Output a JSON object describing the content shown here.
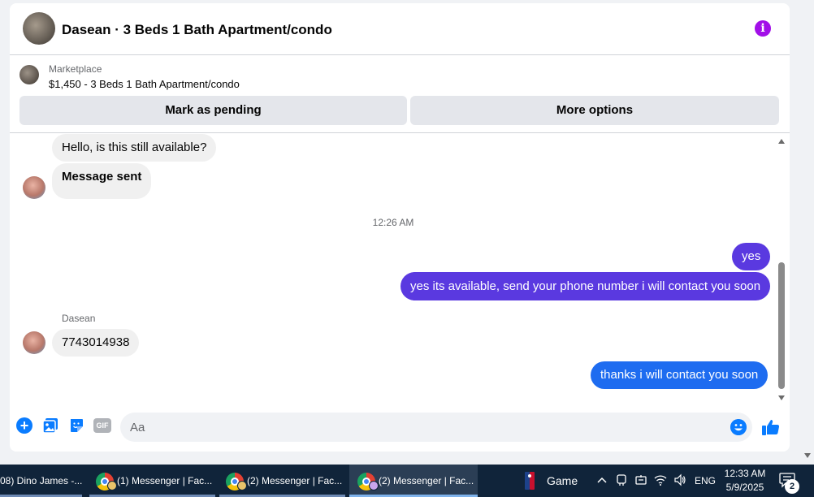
{
  "chat": {
    "title": "Dasean · 3 Beds 1 Bath Apartment/condo",
    "listing": {
      "source": "Marketplace",
      "price_title": "$1,450 - 3 Beds 1 Bath Apartment/condo"
    },
    "buttons": {
      "mark_pending": "Mark as pending",
      "more_options": "More options"
    },
    "messages": [
      {
        "direction": "in",
        "text": "Hello, is this still available?"
      },
      {
        "direction": "in",
        "text": "Message sent"
      },
      {
        "type": "timestamp",
        "text": "12:26 AM"
      },
      {
        "direction": "out",
        "text": "yes"
      },
      {
        "direction": "out",
        "text": "yes its available, send your phone number i will contact you soon"
      },
      {
        "type": "sender",
        "text": "Dasean"
      },
      {
        "direction": "in",
        "text": "7743014938"
      },
      {
        "direction": "out",
        "text": "thanks i will contact you soon"
      }
    ],
    "composer": {
      "placeholder": "Aa",
      "gif_label": "GIF"
    },
    "colors": {
      "accent": "#0a7cff",
      "info": "#a20fe8",
      "outgoing_purple": "#5a39e0",
      "outgoing_blue": "#1e6cf0"
    }
  },
  "taskbar": {
    "items": [
      {
        "label": "08) Dino James -...",
        "active": false
      },
      {
        "label": "(1) Messenger | Fac...",
        "active": false
      },
      {
        "label": "(2) Messenger | Fac...",
        "active": false
      },
      {
        "label": "(2) Messenger | Fac...",
        "active": true
      }
    ],
    "game_label": "Game",
    "language": "ENG",
    "time": "12:33 AM",
    "date": "5/9/2025",
    "notification_count": "2"
  }
}
